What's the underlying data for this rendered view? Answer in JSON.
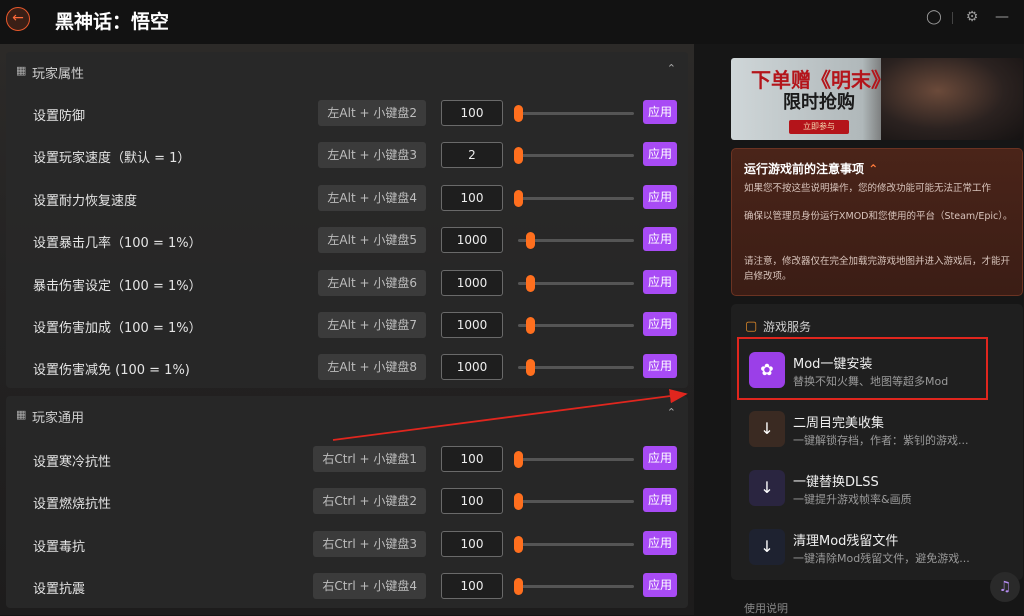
{
  "app": {
    "title": "黑神话：悟空"
  },
  "section1": {
    "title": "玩家属性",
    "rows": [
      {
        "label": "设置防御",
        "hotkey": "左Alt + 小键盘2",
        "value": "100",
        "slider": 0.0,
        "apply": "应用"
      },
      {
        "label": "设置玩家速度（默认 = 1）",
        "hotkey": "左Alt + 小键盘3",
        "value": "2",
        "slider": 0.0,
        "apply": "应用"
      },
      {
        "label": "设置耐力恢复速度",
        "hotkey": "左Alt + 小键盘4",
        "value": "100",
        "slider": 0.0,
        "apply": "应用"
      },
      {
        "label": "设置暴击几率（100 = 1%）",
        "hotkey": "左Alt + 小键盘5",
        "value": "1000",
        "slider": 0.1,
        "apply": "应用"
      },
      {
        "label": "暴击伤害设定（100 = 1%）",
        "hotkey": "左Alt + 小键盘6",
        "value": "1000",
        "slider": 0.1,
        "apply": "应用"
      },
      {
        "label": "设置伤害加成（100 = 1%）",
        "hotkey": "左Alt + 小键盘7",
        "value": "1000",
        "slider": 0.1,
        "apply": "应用"
      },
      {
        "label": "设置伤害减免 (100 = 1%)",
        "hotkey": "左Alt + 小键盘8",
        "value": "1000",
        "slider": 0.1,
        "apply": "应用"
      }
    ]
  },
  "section2": {
    "title": "玩家通用",
    "rows": [
      {
        "label": "设置寒冷抗性",
        "hotkey": "右Ctrl + 小键盘1",
        "value": "100",
        "slider": 0.0,
        "apply": "应用"
      },
      {
        "label": "设置燃烧抗性",
        "hotkey": "右Ctrl + 小键盘2",
        "value": "100",
        "slider": 0.0,
        "apply": "应用"
      },
      {
        "label": "设置毒抗",
        "hotkey": "右Ctrl + 小键盘3",
        "value": "100",
        "slider": 0.0,
        "apply": "应用"
      },
      {
        "label": "设置抗震",
        "hotkey": "右Ctrl + 小键盘4",
        "value": "100",
        "slider": 0.0,
        "apply": "应用"
      }
    ]
  },
  "banner": {
    "line1": "下单赠《明末》",
    "line2": "限时抢购",
    "button": "立即参与"
  },
  "notice": {
    "title": "运行游戏前的注意事项",
    "p1": "如果您不按这些说明操作，您的修改功能可能无法正常工作",
    "p2": "确保以管理员身份运行XMOD和您使用的平台（Steam/Epic）。",
    "p3": "请注意，修改器仅在完全加载完游戏地图并进入游戏后，才能开启修改项。"
  },
  "services": {
    "title": "游戏服务",
    "items": [
      {
        "name": "Mod一键安装",
        "desc": "替换不知火舞、地图等超多Mod",
        "color": "#9b3fe8"
      },
      {
        "name": "二周目完美收集",
        "desc": "一键解锁存档，作者：紫钊的游戏...",
        "color": "#3a2a22"
      },
      {
        "name": "一键替换DLSS",
        "desc": "一键提升游戏帧率&画质",
        "color": "#2a2540"
      },
      {
        "name": "清理Mod残留文件",
        "desc": "一键清除Mod残留文件，避免游戏...",
        "color": "#1e2230"
      }
    ]
  },
  "footer": {
    "peek": "使用说明"
  },
  "colors": {
    "accent": "#a84bf5",
    "slider": "#ff6f1e",
    "highlight": "#e0261e"
  }
}
